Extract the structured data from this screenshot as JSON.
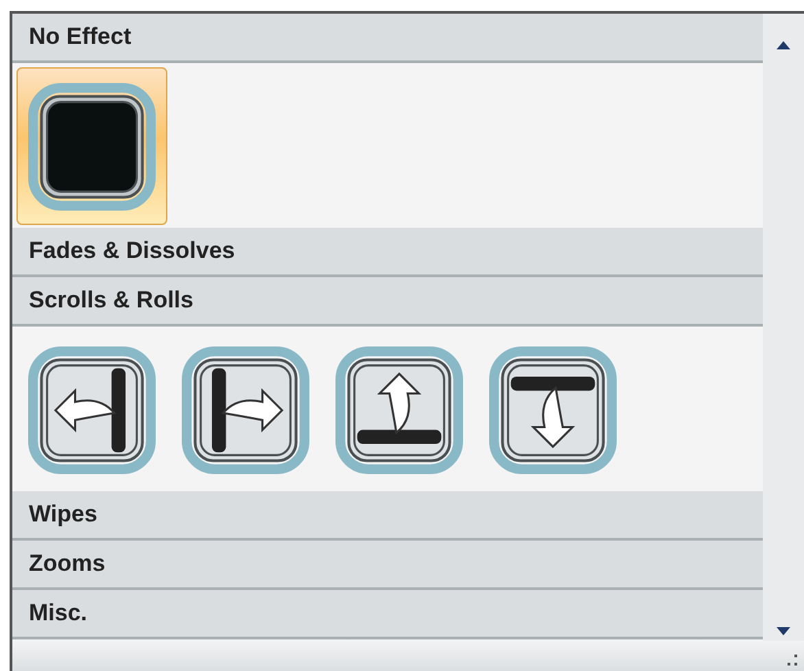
{
  "sections": [
    {
      "title": "No Effect",
      "items": [
        {
          "kind": "blank",
          "selected": true
        }
      ]
    },
    {
      "title": "Fades & Dissolves"
    },
    {
      "title": "Scrolls & Rolls",
      "items": [
        {
          "kind": "scroll-left",
          "selected": false
        },
        {
          "kind": "scroll-right",
          "selected": false
        },
        {
          "kind": "scroll-up",
          "selected": false
        },
        {
          "kind": "scroll-down",
          "selected": false
        }
      ]
    },
    {
      "title": "Wipes"
    },
    {
      "title": "Zooms"
    },
    {
      "title": "Misc."
    }
  ]
}
